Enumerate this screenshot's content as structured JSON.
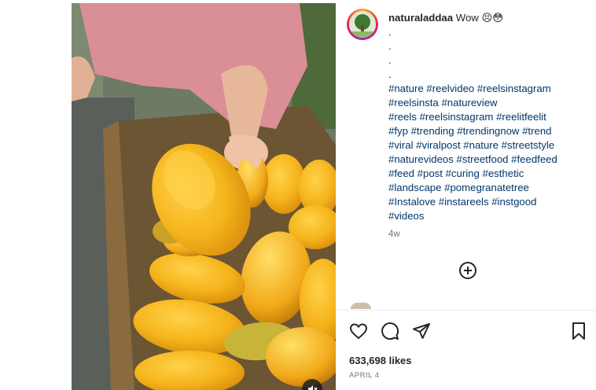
{
  "post": {
    "username": "naturaladdaa",
    "caption_text": "Wow",
    "emojis": "😣😳",
    "dots": [
      ".",
      ".",
      ".",
      "."
    ],
    "hashtags": [
      "#nature #reelvideo #reelsinstagram",
      "#reelsinsta #natureview",
      "#reels #reelsinstagram #reelitfeelit",
      "#fyp #trending #trendingnow #trend",
      "#viral #viralpost #nature #streetstyle",
      "#naturevideos #streetfood #feedfeed",
      "#feed #post #curing #esthetic",
      "#landscape #pomegranatetree",
      "#Instalove #instareels #instgood",
      "#videos"
    ],
    "time_ago": "4w",
    "likes": "633,698 likes",
    "date": "APRIL 4"
  },
  "icons": {
    "like": "heart-icon",
    "comment": "comment-icon",
    "share": "paper-plane-icon",
    "save": "bookmark-icon",
    "add_comment": "plus-circle-icon",
    "mute": "speaker-muted-icon"
  },
  "colors": {
    "hashtag": "#00376b",
    "text": "#262626",
    "muted": "#737373",
    "mango": "#f5b41c"
  }
}
